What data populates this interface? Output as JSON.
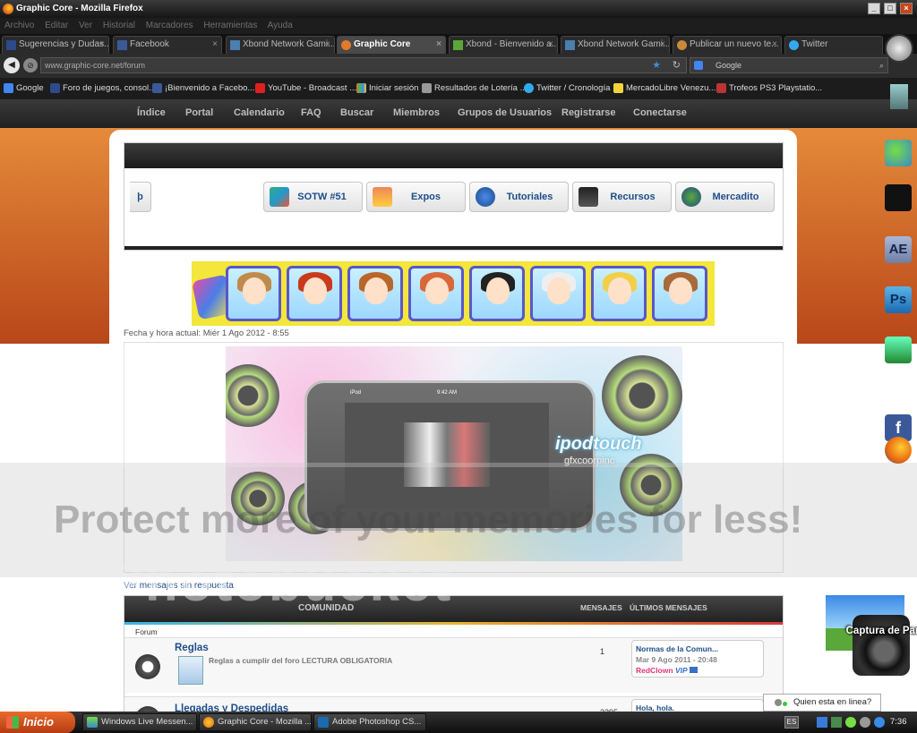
{
  "window": {
    "title": "Graphic Core - Mozilla Firefox"
  },
  "menu": [
    "Archivo",
    "Editar",
    "Ver",
    "Historial",
    "Marcadores",
    "Herramientas",
    "Ayuda"
  ],
  "tabs": [
    {
      "label": "Sugerencias y Dudas...",
      "icon": "forum-icon"
    },
    {
      "label": "Facebook",
      "icon": "facebook-icon"
    },
    {
      "label": "Xbond Network Gami...",
      "icon": "xbond-icon"
    },
    {
      "label": "Graphic Core",
      "icon": "graphic-core-icon"
    },
    {
      "label": "Xbond - Bienvenido a...",
      "icon": "xbond-green-icon"
    },
    {
      "label": "Xbond Network Gami...",
      "icon": "xbond-icon"
    },
    {
      "label": "Publicar un nuevo te...",
      "icon": "monkey-icon"
    },
    {
      "label": "Twitter",
      "icon": "twitter-icon"
    }
  ],
  "navigation": {
    "url": "www.graphic-core.net/forum",
    "search_engine": "Google"
  },
  "bookmarks": [
    "Google",
    "Foro de juegos, consol...",
    "¡Bienvenido a Facebo...",
    "YouTube - Broadcast ...",
    "Iniciar sesión",
    "Resultados de Lotería ...",
    "Twitter / Cronología",
    "MercadoLibre Venezu...",
    "Trofeos PS3 Playstatio..."
  ],
  "site_nav": [
    "Índice",
    "Portal",
    "Calendario",
    "FAQ",
    "Buscar",
    "Miembros",
    "Grupos de Usuarios",
    "Registrarse",
    "Conectarse"
  ],
  "portal_buttons": [
    {
      "label": "SOTW #51"
    },
    {
      "label": "Expos"
    },
    {
      "label": "Tutoriales"
    },
    {
      "label": "Recursos"
    },
    {
      "label": "Mercadito"
    }
  ],
  "datetime": "Fecha y hora actual: Miér 1 Ago 2012 - 8:55",
  "feature": {
    "overlay_text": "ipodtouch",
    "overlay_sub": "gfxcoorpinc",
    "phone_time": "9:42 AM",
    "phone_name": "iPod"
  },
  "watermark": {
    "top": "Photobucket",
    "bottom": "Protect more of your memories for less!"
  },
  "unanswered_link": "Ver mensajes sin respuesta",
  "forum": {
    "header_title": "COMUNIDAD",
    "header_posts": "MENSAJES",
    "header_last": "ÚLTIMOS MENSAJES",
    "subheader": "Forum",
    "rows": [
      {
        "title": "Reglas",
        "description": "Reglas a cumplir del foro LECTURA OBLIGATORIA",
        "count": "1",
        "last_title": "Normas de la Comun...",
        "last_date": "Mar 9 Ago 2011 - 20:48",
        "last_user": "RedClown",
        "last_badge": "VIP"
      },
      {
        "title": "Llegadas y Despedidas",
        "description": "",
        "count": "3295",
        "last_title": "Hola, hola.",
        "last_date": "",
        "last_user": "",
        "last_badge": ""
      }
    ]
  },
  "capture_widget": {
    "label": "Captura de Pantalla"
  },
  "quien": {
    "label": "Quien esta en linea?"
  },
  "taskbar": {
    "start": "Inicio",
    "items": [
      "Windows Live Messen...",
      "Graphic Core - Mozilla ...",
      "Adobe Photoshop CS..."
    ],
    "language": "ES",
    "clock": "7:36"
  },
  "dock": [
    {
      "icon": "messenger-icon"
    },
    {
      "icon": "camera-icon"
    },
    {
      "icon": "after-effects-icon",
      "label": "AE"
    },
    {
      "icon": "photoshop-icon",
      "label": "Ps"
    },
    {
      "icon": "facebook-icon",
      "label": "f"
    },
    {
      "icon": "firefox-icon"
    }
  ],
  "colors": {
    "accent_orange": "#d9652a",
    "link_blue": "#1d4e89",
    "dark_bar": "#2c2c2c"
  }
}
